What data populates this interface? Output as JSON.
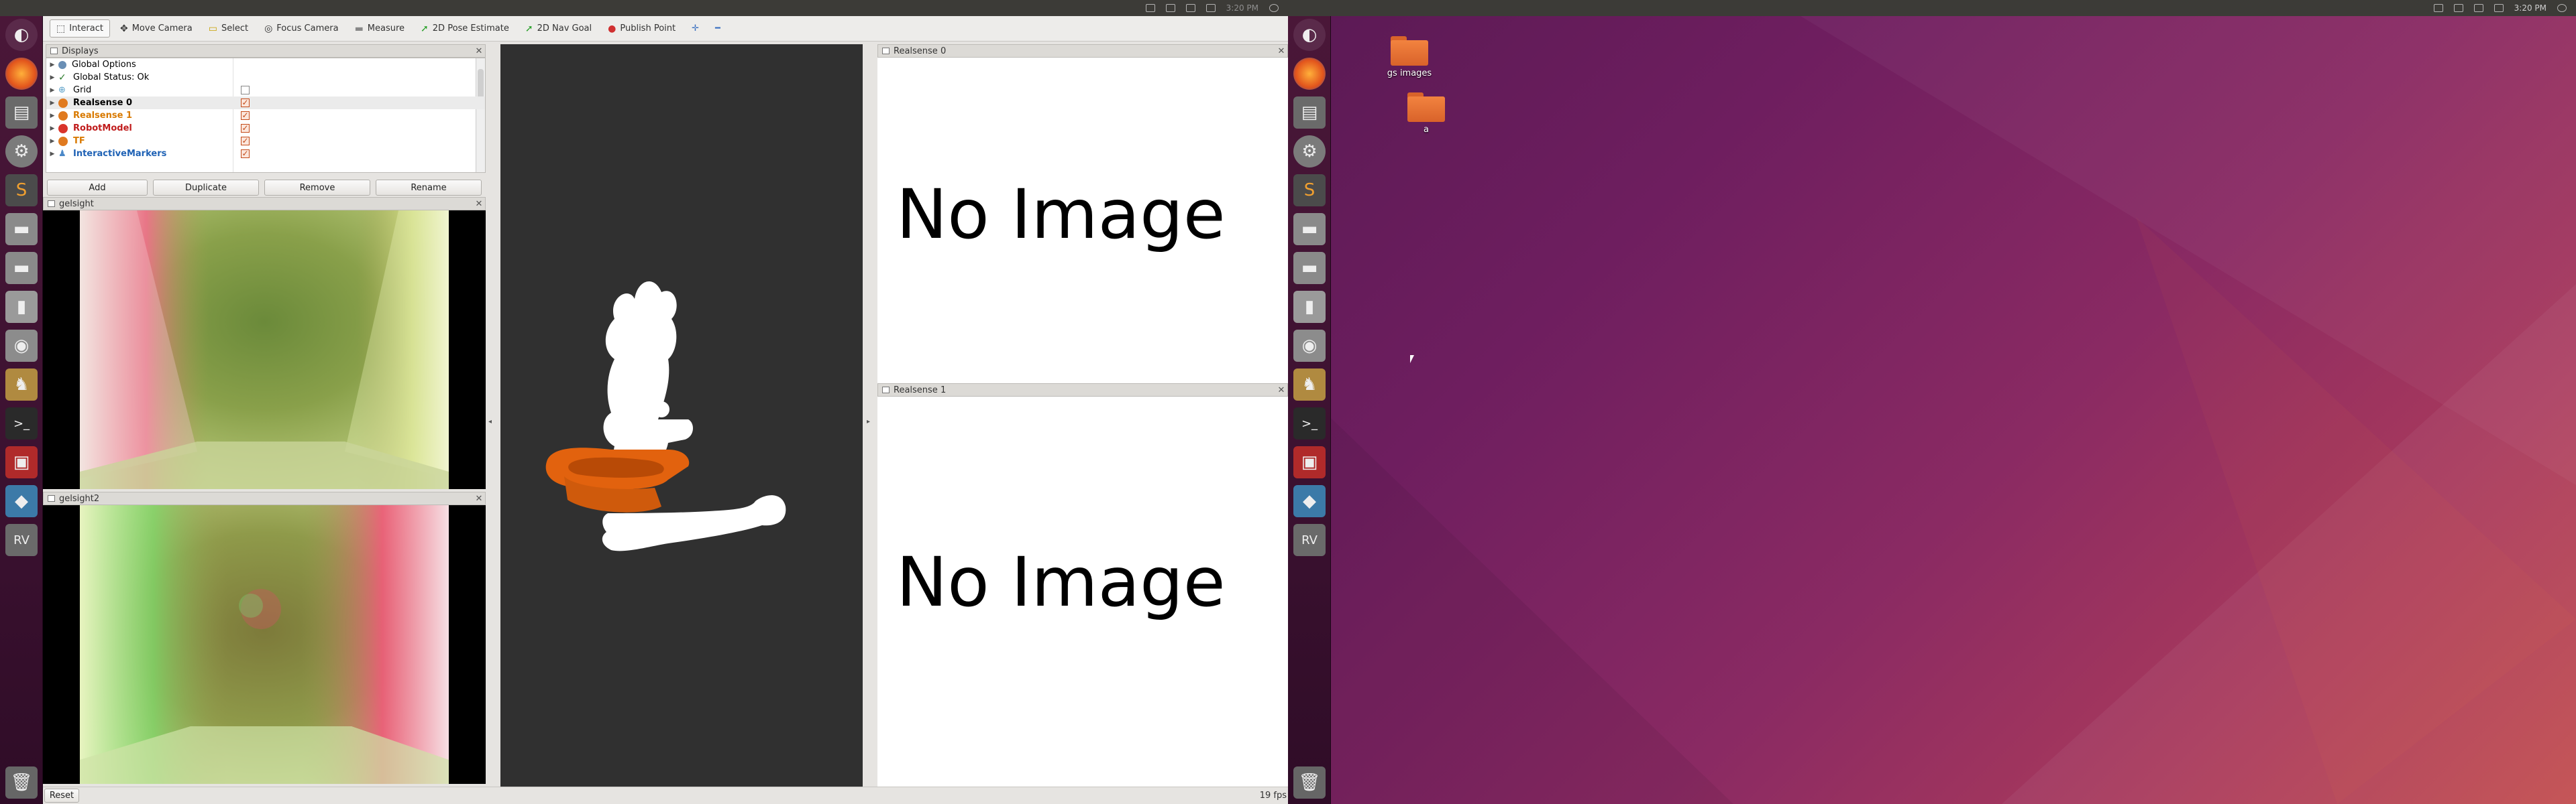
{
  "toolbar": {
    "items": [
      {
        "label": "Interact",
        "icon": "interact-icon",
        "glyph": "⬚"
      },
      {
        "label": "Move Camera",
        "icon": "move-camera-icon",
        "glyph": "✥"
      },
      {
        "label": "Select",
        "icon": "select-icon",
        "glyph": "▭"
      },
      {
        "label": "Focus Camera",
        "icon": "focus-camera-icon",
        "glyph": "◎"
      },
      {
        "label": "Measure",
        "icon": "measure-icon",
        "glyph": "▬"
      },
      {
        "label": "2D Pose Estimate",
        "icon": "pose-estimate-icon",
        "glyph": "➚"
      },
      {
        "label": "2D Nav Goal",
        "icon": "nav-goal-icon",
        "glyph": "➚"
      },
      {
        "label": "Publish Point",
        "icon": "publish-point-icon",
        "glyph": "●"
      }
    ],
    "extra_plus": "✛",
    "extra_minus": "━"
  },
  "displays": {
    "title": "Displays",
    "rows": [
      {
        "label": "Global Options",
        "color": "#6a8fb5",
        "bold": false,
        "text_color": "#222",
        "checked": null
      },
      {
        "label": "Global Status: Ok",
        "color": "check",
        "bold": false,
        "text_color": "#222",
        "checked": null
      },
      {
        "label": "Grid",
        "color": "#5aa0c8",
        "bold": false,
        "text_color": "#222",
        "checked": false
      },
      {
        "label": "Realsense 0",
        "color": "#e07a1f",
        "bold": true,
        "text_color": "#222",
        "checked": true,
        "selected": true
      },
      {
        "label": "Realsense 1",
        "color": "#e07a1f",
        "bold": true,
        "text_color": "#d97a00",
        "checked": true
      },
      {
        "label": "RobotModel",
        "color": "#d9342b",
        "bold": true,
        "text_color": "#c01c1c",
        "checked": true
      },
      {
        "label": "TF",
        "color": "#e07a1f",
        "bold": true,
        "text_color": "#d97a00",
        "checked": true
      },
      {
        "label": "InteractiveMarkers",
        "color": "#4a88c8",
        "bold": true,
        "text_color": "#1f62b5",
        "checked": true
      }
    ],
    "buttons": {
      "add": "Add",
      "duplicate": "Duplicate",
      "remove": "Remove",
      "rename": "Rename"
    }
  },
  "panels": {
    "gelsight": "gelsight",
    "gelsight2": "gelsight2",
    "realsense0": "Realsense 0",
    "realsense1": "Realsense 1",
    "no_image": "No Image"
  },
  "status": {
    "reset": "Reset",
    "fps": "19 fps"
  },
  "topbar_left": {
    "clock": "3:20 PM"
  },
  "topbar_right": {
    "clock": "3:20 PM"
  },
  "desktop": {
    "icons": [
      {
        "label": "gs images"
      },
      {
        "label": "a"
      }
    ]
  },
  "launcher": {
    "items": [
      "ubuntu-dash-icon",
      "firefox-icon",
      "files-icon",
      "settings-icon",
      "sublime-icon",
      "drive-icon",
      "drive-icon",
      "usb-icon",
      "camera-icon",
      "gimp-icon",
      "terminal-icon",
      "vscode-icon",
      "sourcetree-icon",
      "rviz-icon",
      "trash-icon"
    ]
  },
  "colors": {
    "accent": "#e07a1f",
    "desktop_dark": "#5c1a55",
    "desktop_light": "#c24d4f"
  }
}
